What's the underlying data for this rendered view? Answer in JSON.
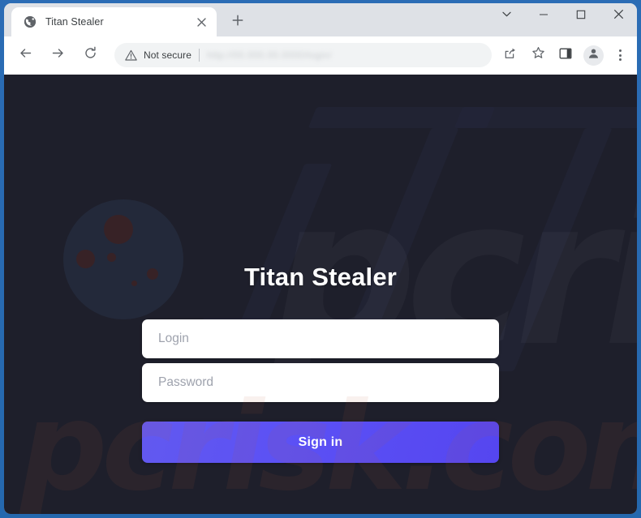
{
  "browser": {
    "tab": {
      "title": "Titan Stealer",
      "favicon_icon": "globe-icon",
      "close_icon": "close-icon"
    },
    "new_tab_icon": "plus-icon",
    "window_controls": {
      "minimize_group_icon": "chevron-down-icon",
      "minimize_icon": "minimize-icon",
      "maximize_icon": "maximize-icon",
      "close_icon": "close-icon"
    },
    "toolbar": {
      "back_icon": "arrow-left-icon",
      "forward_icon": "arrow-right-icon",
      "reload_icon": "reload-icon",
      "security_icon": "warning-triangle-icon",
      "security_label": "Not secure",
      "url_value": "http://00.000.00.0000/login/",
      "share_icon": "share-icon",
      "bookmark_icon": "star-icon",
      "side_panel_icon": "side-panel-icon",
      "profile_icon": "person-avatar-icon",
      "menu_icon": "three-dots-vertical-icon"
    }
  },
  "page": {
    "title": "Titan Stealer",
    "login": {
      "value": "",
      "placeholder": "Login"
    },
    "password": {
      "value": "",
      "placeholder": "Password"
    },
    "submit_label": "Sign in",
    "watermark_text": "pcrisk.com"
  },
  "colors": {
    "page_background": "#1e1f2b",
    "accent_button": "#5b50f5",
    "window_frame": "#2568ae",
    "tabstrip": "#dee1e6",
    "toolbar": "#ffffff",
    "planet": "#252b3d",
    "crater": "#3f2224",
    "placeholder_text": "#9ea2ad"
  }
}
